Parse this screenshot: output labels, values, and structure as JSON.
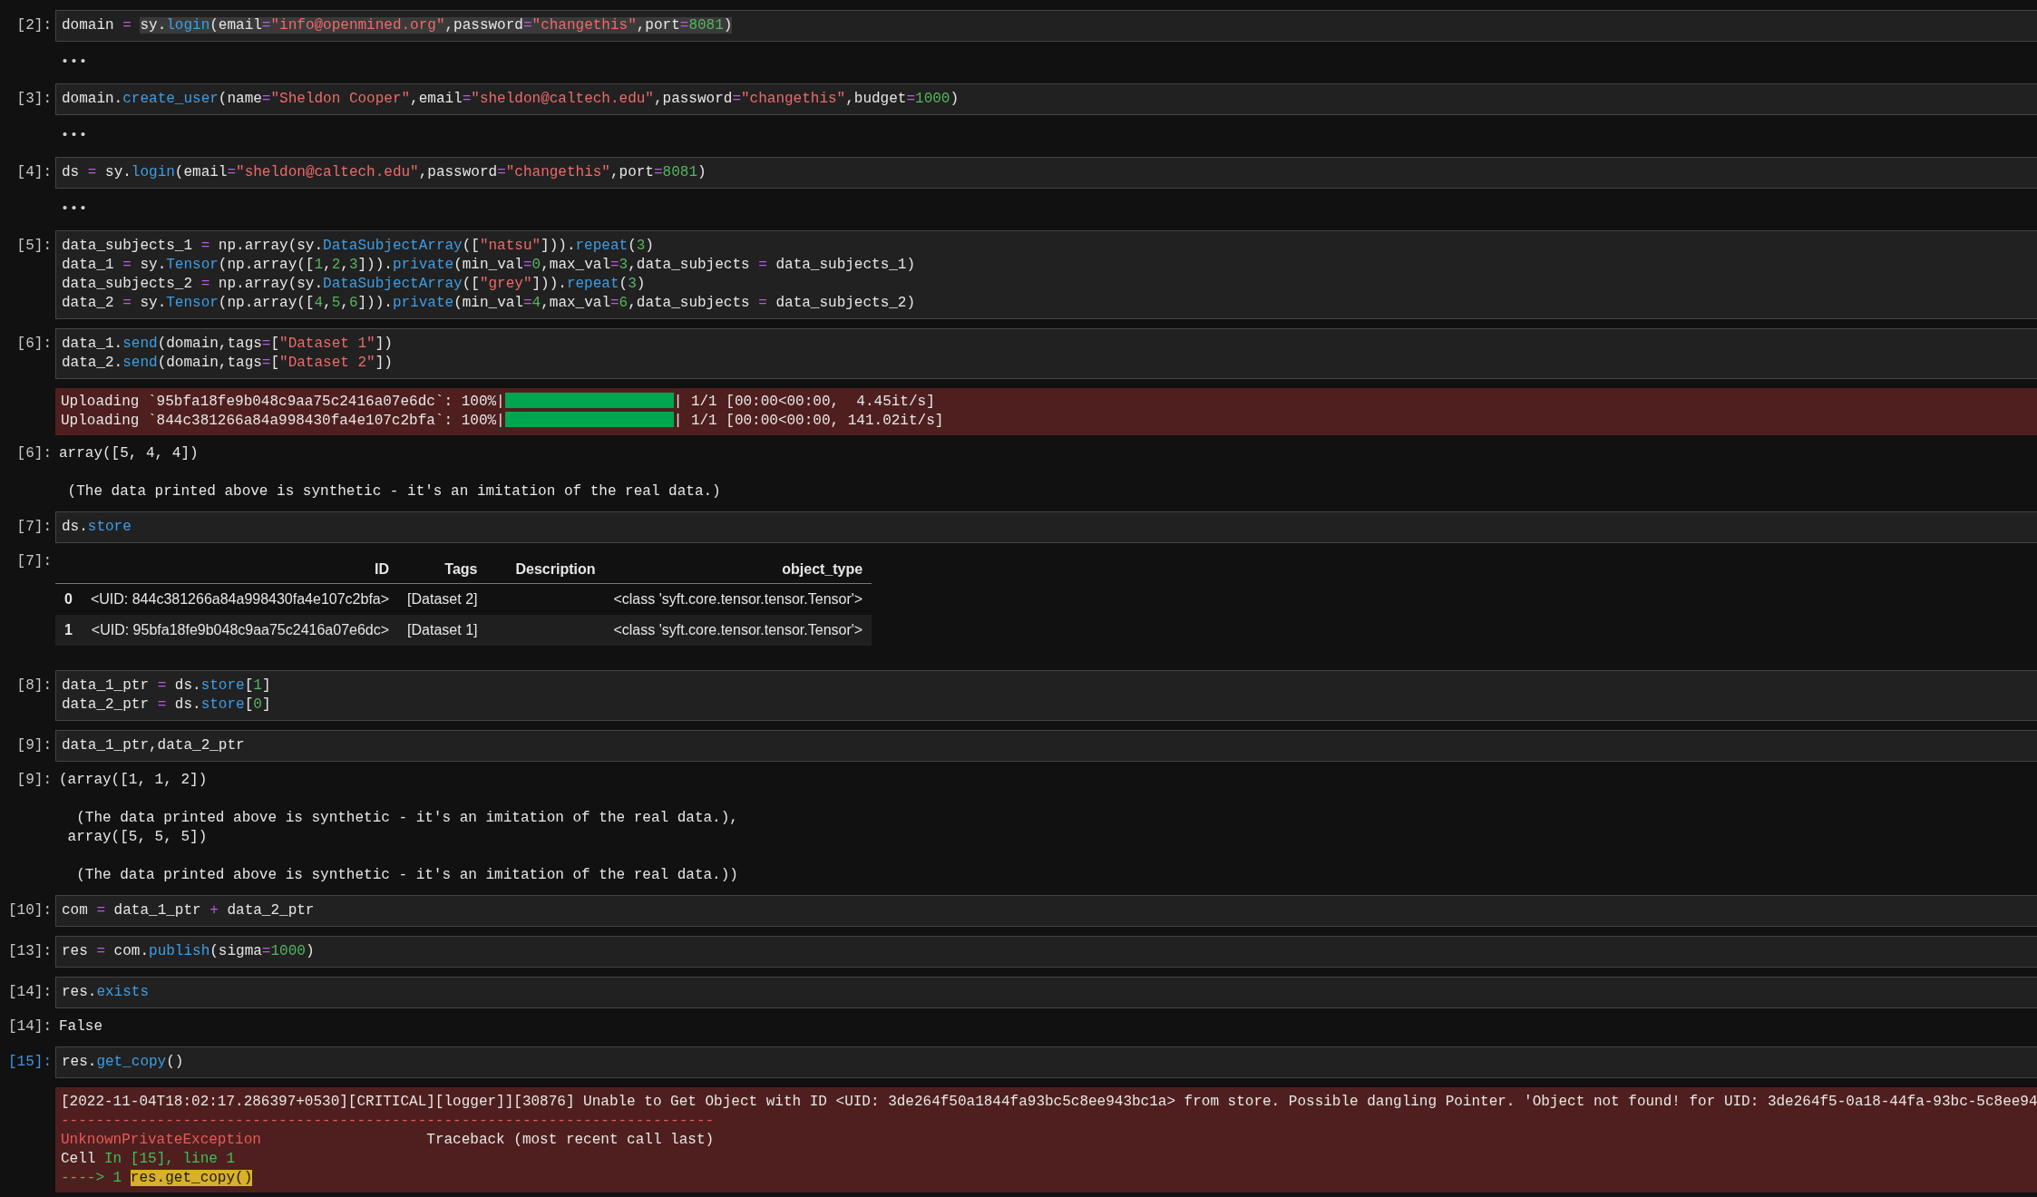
{
  "cells": [
    {
      "kind": "input",
      "prompt": "[2]:",
      "selected": false,
      "lines": [
        [
          {
            "text": "domain ",
            "kind": "plain"
          },
          {
            "text": "= ",
            "kind": "op"
          },
          {
            "kind": "selection",
            "tokens": [
              {
                "text": "sy.",
                "kind": "plain"
              },
              {
                "text": "login",
                "kind": "fn"
              },
              {
                "text": "(email",
                "kind": "plain"
              },
              {
                "text": "=",
                "kind": "op"
              },
              {
                "text": "\"info@openmined.org\"",
                "kind": "str"
              },
              {
                "text": ",password",
                "kind": "plain"
              },
              {
                "text": "=",
                "kind": "op"
              },
              {
                "text": "\"changethis\"",
                "kind": "str"
              },
              {
                "text": ",port",
                "kind": "plain"
              },
              {
                "text": "=",
                "kind": "op"
              },
              {
                "text": "8081",
                "kind": "num"
              },
              {
                "text": ")",
                "kind": "plain"
              }
            ]
          }
        ]
      ]
    },
    {
      "kind": "collapsed",
      "text": "•••"
    },
    {
      "kind": "input",
      "prompt": "[3]:",
      "selected": false,
      "lines": [
        [
          {
            "text": "domain.",
            "kind": "plain"
          },
          {
            "text": "create_user",
            "kind": "fn"
          },
          {
            "text": "(name",
            "kind": "plain"
          },
          {
            "text": "=",
            "kind": "op"
          },
          {
            "text": "\"Sheldon Cooper\"",
            "kind": "str"
          },
          {
            "text": ",email",
            "kind": "plain"
          },
          {
            "text": "=",
            "kind": "op"
          },
          {
            "text": "\"sheldon@caltech.edu\"",
            "kind": "str"
          },
          {
            "text": ",password",
            "kind": "plain"
          },
          {
            "text": "=",
            "kind": "op"
          },
          {
            "text": "\"changethis\"",
            "kind": "str"
          },
          {
            "text": ",budget",
            "kind": "plain"
          },
          {
            "text": "=",
            "kind": "op"
          },
          {
            "text": "1000",
            "kind": "num"
          },
          {
            "text": ")",
            "kind": "plain"
          }
        ]
      ]
    },
    {
      "kind": "collapsed",
      "text": "•••"
    },
    {
      "kind": "input",
      "prompt": "[4]:",
      "selected": false,
      "lines": [
        [
          {
            "text": "ds ",
            "kind": "plain"
          },
          {
            "text": "=",
            "kind": "op"
          },
          {
            "text": " sy.",
            "kind": "plain"
          },
          {
            "text": "login",
            "kind": "fn"
          },
          {
            "text": "(email",
            "kind": "plain"
          },
          {
            "text": "=",
            "kind": "op"
          },
          {
            "text": "\"sheldon@caltech.edu\"",
            "kind": "str"
          },
          {
            "text": ",password",
            "kind": "plain"
          },
          {
            "text": "=",
            "kind": "op"
          },
          {
            "text": "\"changethis\"",
            "kind": "str"
          },
          {
            "text": ",port",
            "kind": "plain"
          },
          {
            "text": "=",
            "kind": "op"
          },
          {
            "text": "8081",
            "kind": "num"
          },
          {
            "text": ")",
            "kind": "plain"
          }
        ]
      ]
    },
    {
      "kind": "collapsed",
      "text": "•••"
    },
    {
      "kind": "input",
      "prompt": "[5]:",
      "selected": false,
      "lines": [
        [
          {
            "text": "data_subjects_1 ",
            "kind": "plain"
          },
          {
            "text": "=",
            "kind": "op"
          },
          {
            "text": " np.array(sy.",
            "kind": "plain"
          },
          {
            "text": "DataSubjectArray",
            "kind": "fn"
          },
          {
            "text": "([",
            "kind": "plain"
          },
          {
            "text": "\"natsu\"",
            "kind": "str"
          },
          {
            "text": "])).",
            "kind": "plain"
          },
          {
            "text": "repeat",
            "kind": "fn"
          },
          {
            "text": "(",
            "kind": "plain"
          },
          {
            "text": "3",
            "kind": "num"
          },
          {
            "text": ")",
            "kind": "plain"
          }
        ],
        [
          {
            "text": "data_1 ",
            "kind": "plain"
          },
          {
            "text": "=",
            "kind": "op"
          },
          {
            "text": " sy.",
            "kind": "plain"
          },
          {
            "text": "Tensor",
            "kind": "fn"
          },
          {
            "text": "(np.array([",
            "kind": "plain"
          },
          {
            "text": "1",
            "kind": "num"
          },
          {
            "text": ",",
            "kind": "plain"
          },
          {
            "text": "2",
            "kind": "num"
          },
          {
            "text": ",",
            "kind": "plain"
          },
          {
            "text": "3",
            "kind": "num"
          },
          {
            "text": "])).",
            "kind": "plain"
          },
          {
            "text": "private",
            "kind": "fn"
          },
          {
            "text": "(min_val",
            "kind": "plain"
          },
          {
            "text": "=",
            "kind": "op"
          },
          {
            "text": "0",
            "kind": "num"
          },
          {
            "text": ",max_val",
            "kind": "plain"
          },
          {
            "text": "=",
            "kind": "op"
          },
          {
            "text": "3",
            "kind": "num"
          },
          {
            "text": ",data_subjects ",
            "kind": "plain"
          },
          {
            "text": "=",
            "kind": "op"
          },
          {
            "text": " data_subjects_1)",
            "kind": "plain"
          }
        ],
        [
          {
            "text": "data_subjects_2 ",
            "kind": "plain"
          },
          {
            "text": "=",
            "kind": "op"
          },
          {
            "text": " np.array(sy.",
            "kind": "plain"
          },
          {
            "text": "DataSubjectArray",
            "kind": "fn"
          },
          {
            "text": "([",
            "kind": "plain"
          },
          {
            "text": "\"grey\"",
            "kind": "str"
          },
          {
            "text": "])).",
            "kind": "plain"
          },
          {
            "text": "repeat",
            "kind": "fn"
          },
          {
            "text": "(",
            "kind": "plain"
          },
          {
            "text": "3",
            "kind": "num"
          },
          {
            "text": ")",
            "kind": "plain"
          }
        ],
        [
          {
            "text": "data_2 ",
            "kind": "plain"
          },
          {
            "text": "=",
            "kind": "op"
          },
          {
            "text": " sy.",
            "kind": "plain"
          },
          {
            "text": "Tensor",
            "kind": "fn"
          },
          {
            "text": "(np.array([",
            "kind": "plain"
          },
          {
            "text": "4",
            "kind": "num"
          },
          {
            "text": ",",
            "kind": "plain"
          },
          {
            "text": "5",
            "kind": "num"
          },
          {
            "text": ",",
            "kind": "plain"
          },
          {
            "text": "6",
            "kind": "num"
          },
          {
            "text": "])).",
            "kind": "plain"
          },
          {
            "text": "private",
            "kind": "fn"
          },
          {
            "text": "(min_val",
            "kind": "plain"
          },
          {
            "text": "=",
            "kind": "op"
          },
          {
            "text": "4",
            "kind": "num"
          },
          {
            "text": ",max_val",
            "kind": "plain"
          },
          {
            "text": "=",
            "kind": "op"
          },
          {
            "text": "6",
            "kind": "num"
          },
          {
            "text": ",data_subjects ",
            "kind": "plain"
          },
          {
            "text": "=",
            "kind": "op"
          },
          {
            "text": " data_subjects_2)",
            "kind": "plain"
          }
        ]
      ]
    },
    {
      "kind": "input",
      "prompt": "[6]:",
      "selected": false,
      "lines": [
        [
          {
            "text": "data_1.",
            "kind": "plain"
          },
          {
            "text": "send",
            "kind": "fn"
          },
          {
            "text": "(domain,tags",
            "kind": "plain"
          },
          {
            "text": "=",
            "kind": "op"
          },
          {
            "text": "[",
            "kind": "plain"
          },
          {
            "text": "\"Dataset 1\"",
            "kind": "str"
          },
          {
            "text": "])",
            "kind": "plain"
          }
        ],
        [
          {
            "text": "data_2.",
            "kind": "plain"
          },
          {
            "text": "send",
            "kind": "fn"
          },
          {
            "text": "(domain,tags",
            "kind": "plain"
          },
          {
            "text": "=",
            "kind": "op"
          },
          {
            "text": "[",
            "kind": "plain"
          },
          {
            "text": "\"Dataset 2\"",
            "kind": "str"
          },
          {
            "text": "])",
            "kind": "plain"
          }
        ]
      ]
    },
    {
      "kind": "stderr",
      "lines": [
        {
          "text": "Uploading `95bfa18fe9b048c9aa75c2416a07e6dc`: 100%|",
          "level": 1,
          "tail": "| 1/1 [00:00<00:00,  4.45it/s]"
        },
        {
          "text": "Uploading `844c381266a84a998430fa4e107c2bfa`: 100%|",
          "level": 1,
          "tail": "| 1/1 [00:00<00:00, 141.02it/s]"
        }
      ]
    },
    {
      "kind": "output",
      "prompt": "[6]:",
      "blocks": [
        [
          "array([5, 4, 4])"
        ],
        [
          " (The data printed above is synthetic - it's an imitation of the real data.)"
        ]
      ]
    },
    {
      "kind": "input",
      "prompt": "[7]:",
      "selected": false,
      "lines": [
        [
          {
            "text": "ds.",
            "kind": "plain"
          },
          {
            "text": "store",
            "kind": "fn"
          }
        ]
      ]
    },
    {
      "kind": "table",
      "prompt": "[7]:",
      "columns": [
        "ID",
        "Tags",
        "Description",
        "object_type"
      ],
      "rows": [
        {
          "index": "0",
          "id": "<UID: 844c381266a84a998430fa4e107c2bfa>",
          "tags": "[Dataset 2]",
          "object_type": "<class 'syft.core.tensor.tensor.Tensor'>"
        },
        {
          "index": "1",
          "id": "<UID: 95bfa18fe9b048c9aa75c2416a07e6dc>",
          "tags": "[Dataset 1]",
          "object_type": "<class 'syft.core.tensor.tensor.Tensor'>"
        }
      ]
    },
    {
      "kind": "input",
      "prompt": "[8]:",
      "selected": false,
      "lines": [
        [
          {
            "text": "data_1_ptr ",
            "kind": "plain"
          },
          {
            "text": "=",
            "kind": "op"
          },
          {
            "text": " ds.",
            "kind": "plain"
          },
          {
            "text": "store",
            "kind": "fn"
          },
          {
            "text": "[",
            "kind": "plain"
          },
          {
            "text": "1",
            "kind": "num"
          },
          {
            "text": "]",
            "kind": "plain"
          }
        ],
        [
          {
            "text": "data_2_ptr ",
            "kind": "plain"
          },
          {
            "text": "=",
            "kind": "op"
          },
          {
            "text": " ds.",
            "kind": "plain"
          },
          {
            "text": "store",
            "kind": "fn"
          },
          {
            "text": "[",
            "kind": "plain"
          },
          {
            "text": "0",
            "kind": "num"
          },
          {
            "text": "]",
            "kind": "plain"
          }
        ]
      ]
    },
    {
      "kind": "input",
      "prompt": "[9]:",
      "selected": false,
      "lines": [
        [
          {
            "text": "data_1_ptr,data_2_ptr",
            "kind": "plain"
          }
        ]
      ]
    },
    {
      "kind": "output",
      "prompt": "[9]:",
      "blocks": [
        [
          "(array([1, 1, 2])"
        ],
        [
          "  (The data printed above is synthetic - it's an imitation of the real data.),",
          " array([5, 5, 5])"
        ],
        [
          "  (The data printed above is synthetic - it's an imitation of the real data.))"
        ]
      ]
    },
    {
      "kind": "input",
      "prompt": "[10]:",
      "selected": false,
      "lines": [
        [
          {
            "text": "com ",
            "kind": "plain"
          },
          {
            "text": "=",
            "kind": "op"
          },
          {
            "text": " data_1_ptr ",
            "kind": "plain"
          },
          {
            "text": "+",
            "kind": "op"
          },
          {
            "text": " data_2_ptr",
            "kind": "plain"
          }
        ]
      ]
    },
    {
      "kind": "input",
      "prompt": "[13]:",
      "selected": false,
      "lines": [
        [
          {
            "text": "res ",
            "kind": "plain"
          },
          {
            "text": "=",
            "kind": "op"
          },
          {
            "text": " com.",
            "kind": "plain"
          },
          {
            "text": "publish",
            "kind": "fn"
          },
          {
            "text": "(sigma",
            "kind": "plain"
          },
          {
            "text": "=",
            "kind": "op"
          },
          {
            "text": "1000",
            "kind": "num"
          },
          {
            "text": ")",
            "kind": "plain"
          }
        ]
      ]
    },
    {
      "kind": "input",
      "prompt": "[14]:",
      "selected": false,
      "lines": [
        [
          {
            "text": "res.",
            "kind": "plain"
          },
          {
            "text": "exists",
            "kind": "fn"
          }
        ]
      ]
    },
    {
      "kind": "output",
      "prompt": "[14]:",
      "blocks": [
        [
          "False"
        ]
      ]
    },
    {
      "kind": "input",
      "prompt": "[15]:",
      "selected": true,
      "lines": [
        [
          {
            "text": "res.",
            "kind": "plain"
          },
          {
            "text": "get_copy",
            "kind": "fn"
          },
          {
            "text": "()",
            "kind": "plain"
          }
        ]
      ]
    },
    {
      "kind": "error",
      "lines": [
        [
          {
            "text": "[2022-11-04T18:02:17.286397+0530][CRITICAL][logger]][30876] Unable to Get Object with ID <UID: 3de264f50a1844fa93bc5c8ee943bc1a> from store. Possible dangling Pointer. 'Object not found! for UID: 3de264f5-0a18-44fa-93bc-5c8ee94",
            "kind": "plain"
          }
        ],
        [
          {
            "text": "---------------------------------------------------------------------------",
            "kind": "err"
          }
        ],
        [
          {
            "text": "UnknownPrivateException",
            "kind": "err"
          },
          {
            "text": "                   Traceback (most recent call last)",
            "kind": "plain"
          }
        ],
        [
          {
            "text": "Cell ",
            "kind": "plain"
          },
          {
            "text": "In [15], line 1",
            "kind": "ok"
          }
        ],
        [
          {
            "text": "----> 1 ",
            "kind": "ok"
          },
          {
            "text": "res.get_copy()",
            "kind": "mark"
          }
        ]
      ]
    }
  ]
}
